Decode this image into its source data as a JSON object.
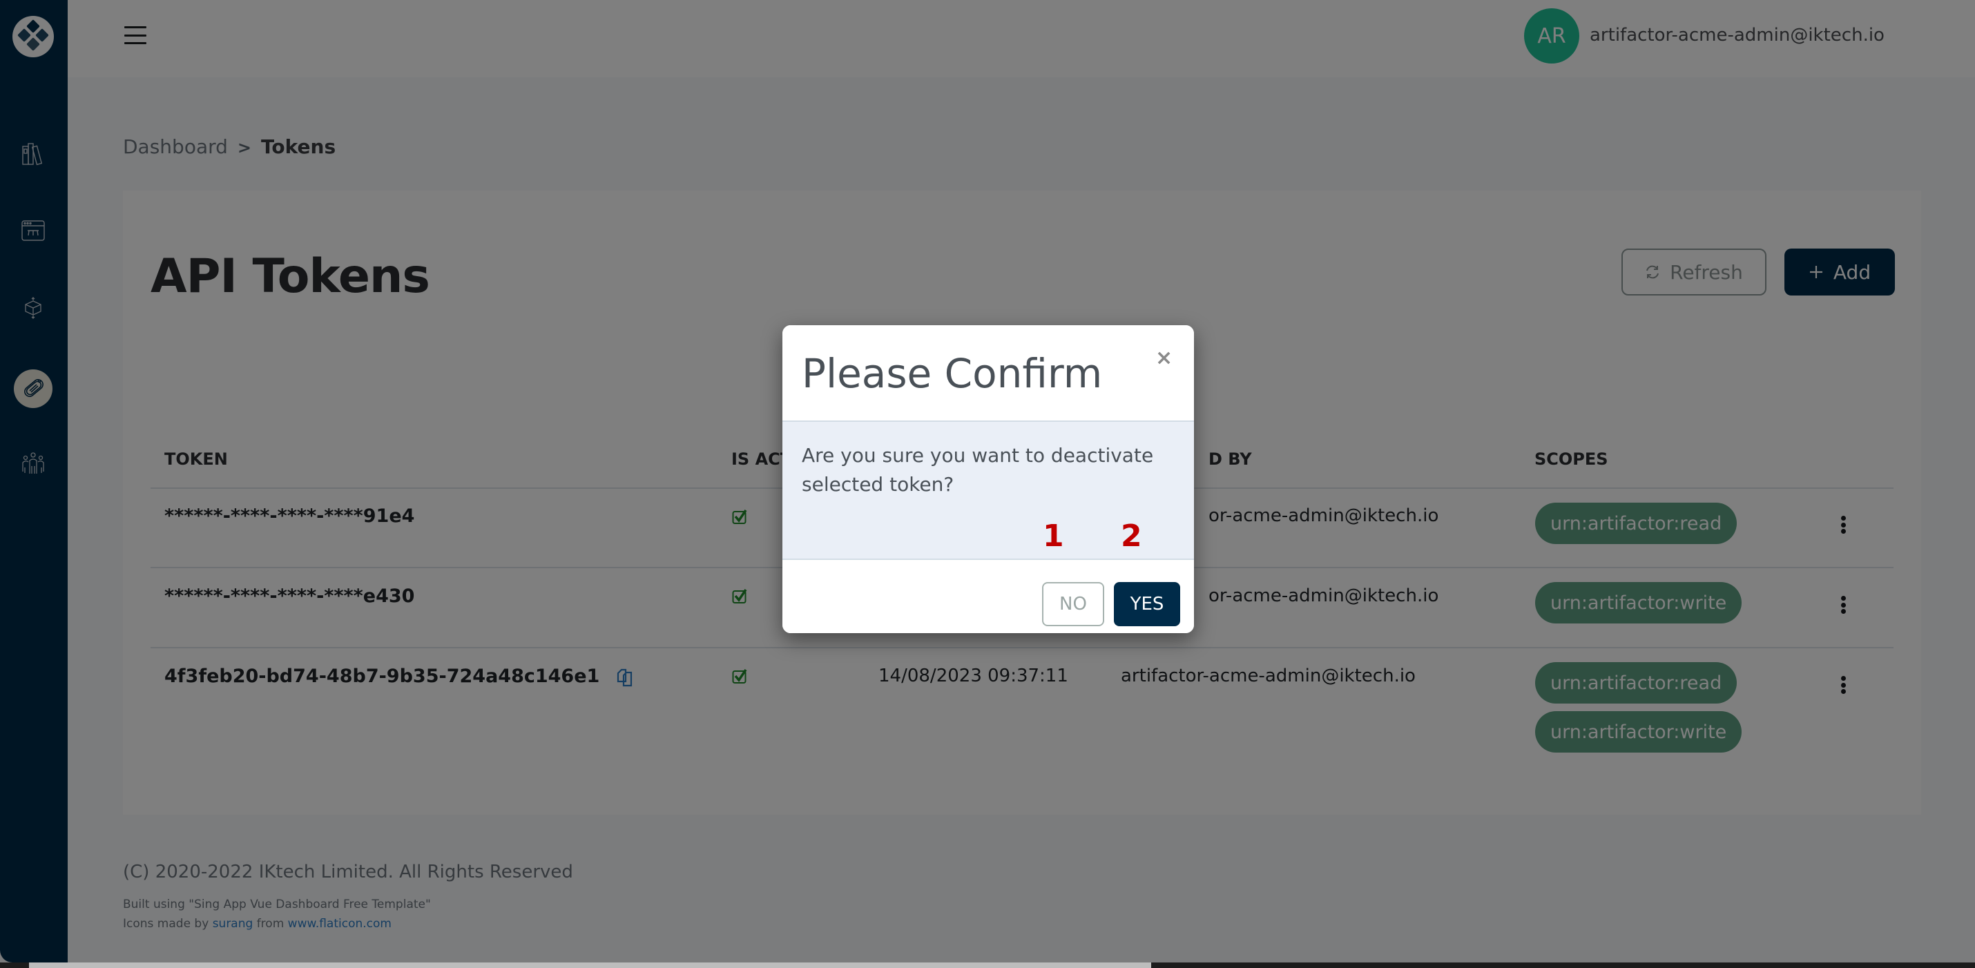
{
  "sidebar": {
    "logo": "app-logo",
    "items": [
      {
        "name": "library-icon",
        "active": false
      },
      {
        "name": "workflow-icon",
        "active": false
      },
      {
        "name": "network-cube-icon",
        "active": false
      },
      {
        "name": "token-tag-icon",
        "active": true
      },
      {
        "name": "users-group-icon",
        "active": false
      }
    ]
  },
  "header": {
    "menu_icon": "hamburger-icon",
    "avatar_initials": "AR",
    "user_email": "artifactor-acme-admin@iktech.io",
    "avatar_color": "#21c197"
  },
  "breadcrumb": {
    "parent": "Dashboard",
    "separator": ">",
    "current": "Tokens"
  },
  "page": {
    "title": "API Tokens",
    "refresh_label": "Refresh",
    "add_label": "Add"
  },
  "table": {
    "headers": {
      "token": "TOKEN",
      "is_active": "IS ACTIVE",
      "created_by": "CREATED BY",
      "scopes": "SCOPES"
    },
    "visible_headers": {
      "is_active": "IS ACT",
      "created_by": "D BY"
    },
    "rows": [
      {
        "token": "******-****-****-****91e4",
        "active": true,
        "created_by_visible": "or-acme-admin@iktech.io",
        "scopes": [
          "urn:artifactor:read"
        ]
      },
      {
        "token": "******-****-****-****e430",
        "active": true,
        "created_by_visible": "or-acme-admin@iktech.io",
        "scopes": [
          "urn:artifactor:write"
        ]
      },
      {
        "token": "4f3feb20-bd74-48b7-9b35-724a48c146e1",
        "active": true,
        "created_at": "14/08/2023 09:37:11",
        "created_by_visible": "artifactor-acme-admin@iktech.io",
        "scopes": [
          "urn:artifactor:read",
          "urn:artifactor:write"
        ]
      }
    ]
  },
  "footer": {
    "copyright": "(C) 2020-2022 IKtech Limited. All Rights Reserved",
    "built_using": "Built using \"Sing App Vue Dashboard Free Template\"",
    "icons_prefix": "Icons made by ",
    "icons_author": "surang",
    "icons_from": " from ",
    "icons_site": "www.flaticon.com"
  },
  "modal": {
    "title": "Please Confirm",
    "close_symbol": "×",
    "message": "Are you sure you want to deactivate selected token?",
    "no_label": "NO",
    "yes_label": "YES",
    "marker_1": "1",
    "marker_2": "2"
  },
  "colors": {
    "sidebar": "#002b49",
    "primary": "#002b49",
    "scope_badge": "#5f9f82",
    "check": "#1f8a2a",
    "marker": "#c00000"
  }
}
